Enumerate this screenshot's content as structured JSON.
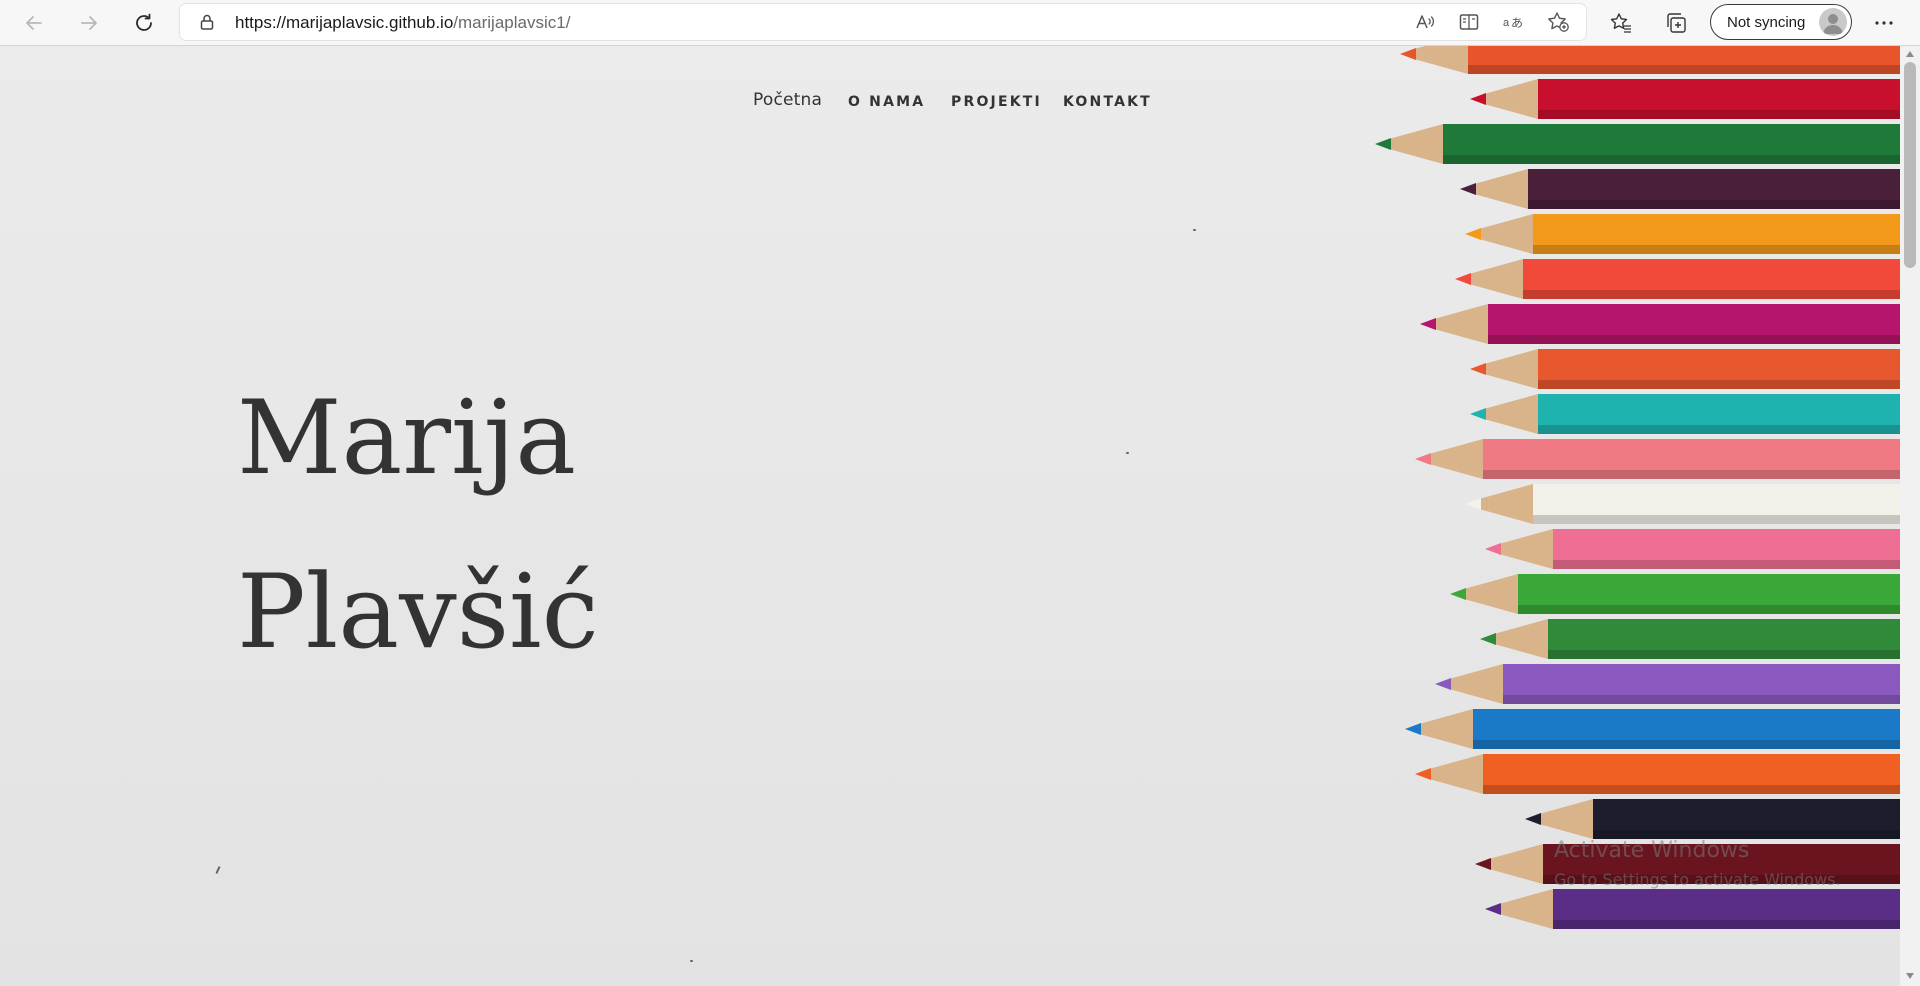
{
  "browser": {
    "url_host": "https://marijaplavsic.github.io",
    "url_path": "/marijaplavsic1/",
    "sync_label": "Not syncing",
    "icons": {
      "back": "back-arrow-icon",
      "forward": "forward-arrow-icon",
      "refresh": "refresh-icon",
      "lock": "lock-icon",
      "read_aloud": "read-aloud-icon",
      "immersive_reader": "immersive-reader-icon",
      "translate": "translate-icon",
      "add_favorite": "add-favorite-icon",
      "favorites": "favorites-icon",
      "collections": "collections-icon",
      "more": "more-icon"
    }
  },
  "site": {
    "nav": {
      "home": "Početna",
      "about": "O NAMA",
      "projects": "PROJEKTI",
      "contact": "KONTAKT"
    },
    "hero": {
      "first_name": "Marija",
      "last_name": "Plavšić"
    }
  },
  "watermark": {
    "title": "Activate Windows",
    "subtitle": "Go to Settings to activate Windows."
  },
  "pencil_colors": [
    "#e8552b",
    "#c8102e",
    "#1f7a3a",
    "#4a1f3a",
    "#f39a1a",
    "#f24a3a",
    "#b5156a",
    "#e8582e",
    "#1fb3b0",
    "#f07a84",
    "#f4f1ea",
    "#ef6e93",
    "#3aa838",
    "#2f8a3a",
    "#8a5ac0",
    "#1a7ac8",
    "#f06022",
    "#1d1d2e",
    "#6a1420",
    "#5a2e86"
  ]
}
